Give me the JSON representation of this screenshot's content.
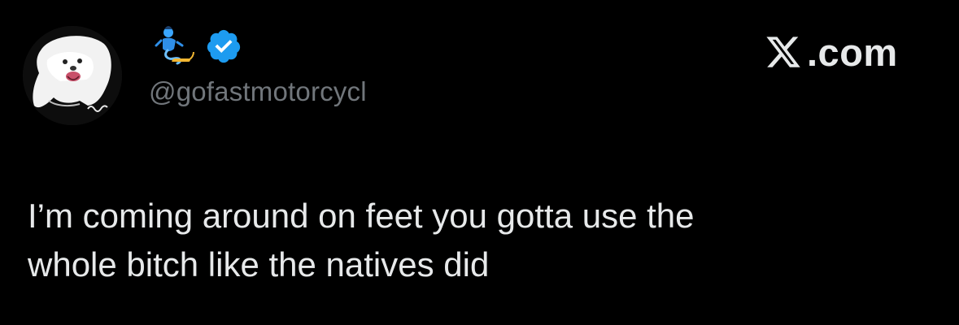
{
  "user": {
    "handle": "@gofastmotorcycl",
    "badge_color": "#1d9bf0",
    "emoji_icon": "genie-icon",
    "verified_icon": "verified-badge-icon"
  },
  "brand": {
    "label": ".com",
    "icon": "x-logo-icon"
  },
  "tweet": {
    "lines": [
      "I’m coming around on feet you gotta use the",
      "whole bitch like the natives did"
    ]
  }
}
